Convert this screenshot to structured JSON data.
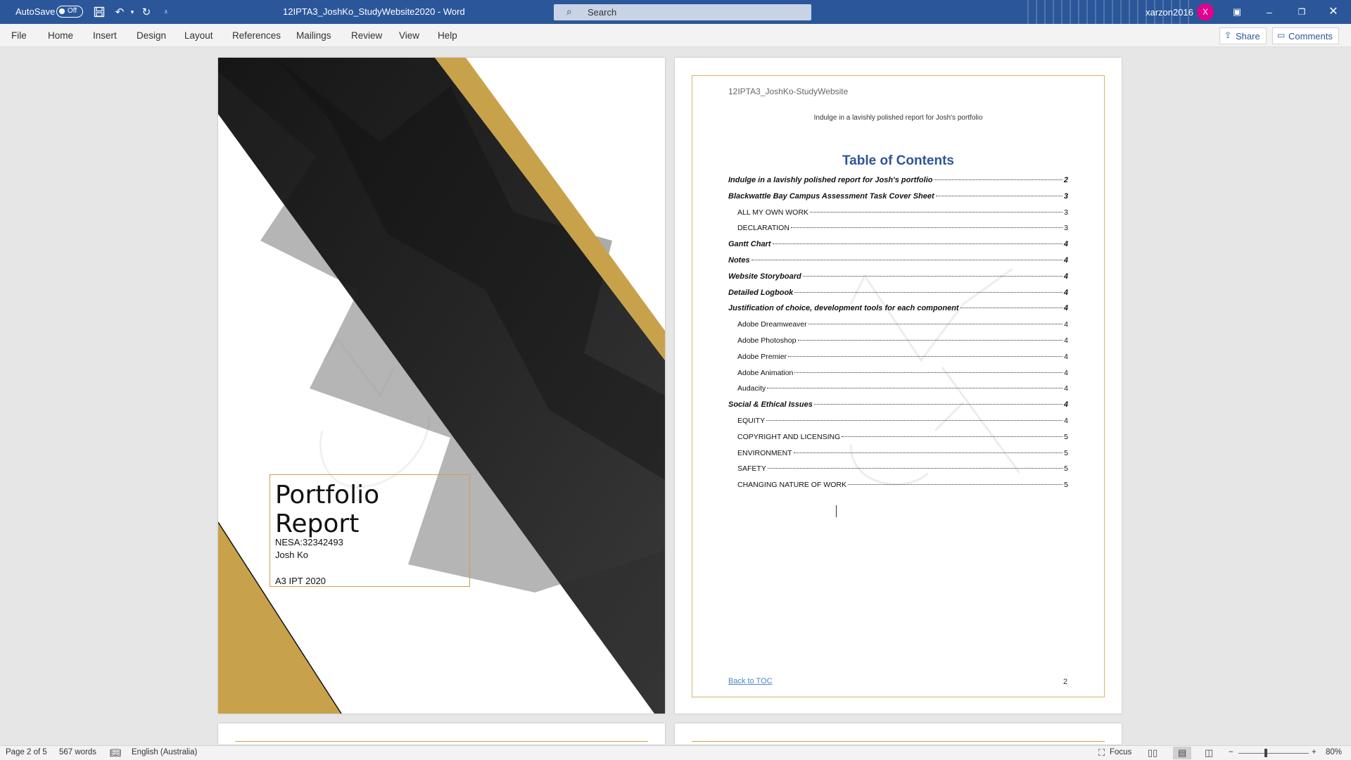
{
  "titlebar": {
    "autosave_label": "AutoSave",
    "autosave_state": "Off",
    "doc_title": "12IPTA3_JoshKo_StudyWebsite2020 - Word",
    "search_placeholder": "Search",
    "user_name": "xarzon2016",
    "avatar_initial": "X"
  },
  "ribbon": {
    "tabs": [
      "File",
      "Home",
      "Insert",
      "Design",
      "Layout",
      "References",
      "Mailings",
      "Review",
      "View",
      "Help"
    ],
    "share_label": "Share",
    "comments_label": "Comments"
  },
  "cover": {
    "title": "Portfolio Report",
    "nesa": "NESA:32342493",
    "author": "Josh Ko",
    "course": "A3 IPT 2020",
    "colors": {
      "gold": "#c8a24b",
      "dark": "#1f1f1f"
    }
  },
  "page2": {
    "header": "12IPTA3_JoshKo-StudyWebsite",
    "subtitle": "Indulge in a lavishly polished report for Josh's portfolio",
    "toc_title": "Table of Contents",
    "toc": [
      {
        "label": "Indulge in a lavishly polished report for Josh's portfolio",
        "page": "2",
        "level": "major"
      },
      {
        "label": "Blackwattle Bay Campus Assessment Task Cover Sheet",
        "page": "3",
        "level": "major"
      },
      {
        "label": "ALL MY OWN WORK",
        "page": "3",
        "level": "sub"
      },
      {
        "label": "DECLARATION",
        "page": "3",
        "level": "sub"
      },
      {
        "label": "Gantt Chart",
        "page": "4",
        "level": "major"
      },
      {
        "label": "Notes",
        "page": "4",
        "level": "major"
      },
      {
        "label": "Website Storyboard",
        "page": "4",
        "level": "major"
      },
      {
        "label": "Detailed Logbook",
        "page": "4",
        "level": "major"
      },
      {
        "label": "Justification of choice, development tools for each component",
        "page": "4",
        "level": "major"
      },
      {
        "label": "Adobe Dreamweaver",
        "page": "4",
        "level": "sub"
      },
      {
        "label": "Adobe Photoshop",
        "page": "4",
        "level": "sub"
      },
      {
        "label": "Adobe Premier",
        "page": "4",
        "level": "sub"
      },
      {
        "label": "Adobe Animation",
        "page": "4",
        "level": "sub"
      },
      {
        "label": "Audacity",
        "page": "4",
        "level": "sub"
      },
      {
        "label": "Social & Ethical Issues",
        "page": "4",
        "level": "major"
      },
      {
        "label": "EQUITY",
        "page": "4",
        "level": "sub"
      },
      {
        "label": "COPYRIGHT AND LICENSING",
        "page": "5",
        "level": "sub"
      },
      {
        "label": "ENVIRONMENT",
        "page": "5",
        "level": "sub"
      },
      {
        "label": "SAFETY",
        "page": "5",
        "level": "sub"
      },
      {
        "label": "CHANGING NATURE OF WORK",
        "page": "5",
        "level": "sub"
      }
    ],
    "back_link": "Back to TOC",
    "page_number": "2"
  },
  "status": {
    "page_info": "Page 2 of 5",
    "word_count": "567 words",
    "language": "English (Australia)",
    "focus_label": "Focus",
    "zoom": "80%"
  }
}
